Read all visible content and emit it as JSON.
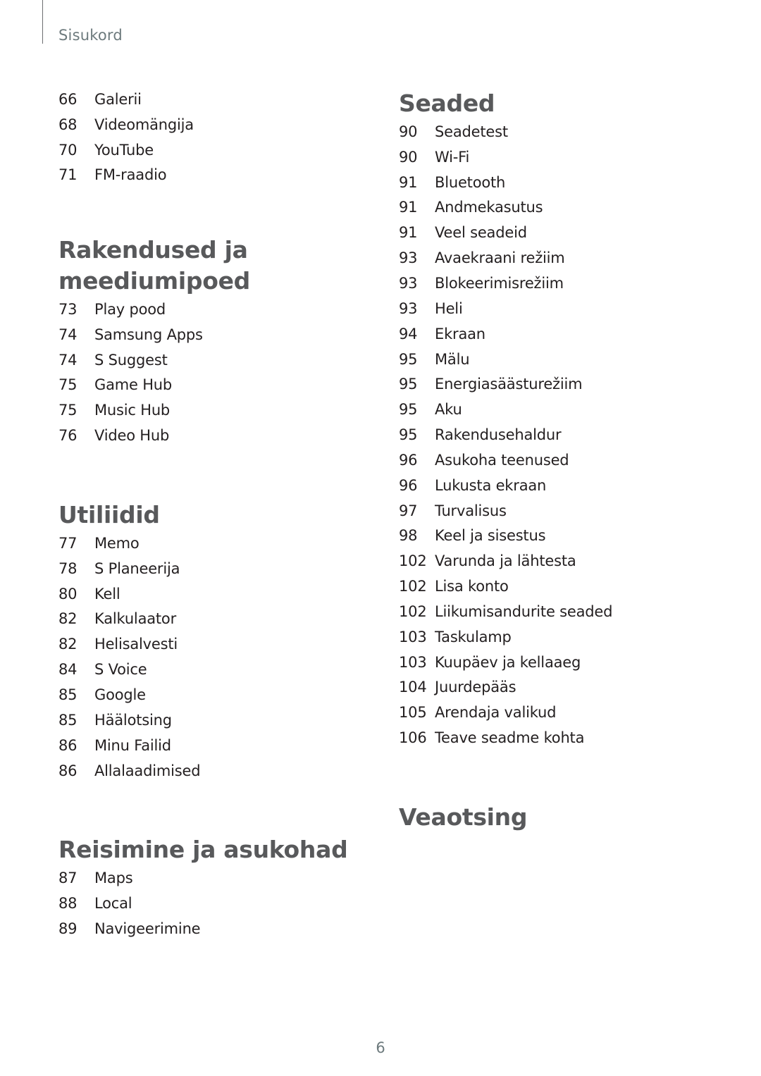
{
  "header": {
    "title": "Sisukord"
  },
  "left_column": {
    "intro_items": [
      {
        "page": "66",
        "label": "Galerii"
      },
      {
        "page": "68",
        "label": "Videomängija"
      },
      {
        "page": "70",
        "label": "YouTube"
      },
      {
        "page": "71",
        "label": "FM-raadio"
      }
    ],
    "sections": [
      {
        "title_line1": "Rakendused ja",
        "title_line2": "meediumipoed",
        "items": [
          {
            "page": "73",
            "label": "Play pood"
          },
          {
            "page": "74",
            "label": "Samsung Apps"
          },
          {
            "page": "74",
            "label": "S Suggest"
          },
          {
            "page": "75",
            "label": "Game Hub"
          },
          {
            "page": "75",
            "label": "Music Hub"
          },
          {
            "page": "76",
            "label": "Video Hub"
          }
        ]
      },
      {
        "title": "Utiliidid",
        "items": [
          {
            "page": "77",
            "label": "Memo"
          },
          {
            "page": "78",
            "label": "S Planeerija"
          },
          {
            "page": "80",
            "label": "Kell"
          },
          {
            "page": "82",
            "label": "Kalkulaator"
          },
          {
            "page": "82",
            "label": "Helisalvesti"
          },
          {
            "page": "84",
            "label": "S Voice"
          },
          {
            "page": "85",
            "label": "Google"
          },
          {
            "page": "85",
            "label": "Häälotsing"
          },
          {
            "page": "86",
            "label": "Minu Failid"
          },
          {
            "page": "86",
            "label": "Allalaadimised"
          }
        ]
      },
      {
        "title": "Reisimine ja asukohad",
        "items": [
          {
            "page": "87",
            "label": "Maps"
          },
          {
            "page": "88",
            "label": "Local"
          },
          {
            "page": "89",
            "label": "Navigeerimine"
          }
        ]
      }
    ]
  },
  "right_column": {
    "sections": [
      {
        "title": "Seaded",
        "items": [
          {
            "page": "90",
            "label": "Seadetest"
          },
          {
            "page": "90",
            "label": "Wi-Fi"
          },
          {
            "page": "91",
            "label": "Bluetooth"
          },
          {
            "page": "91",
            "label": "Andmekasutus"
          },
          {
            "page": "91",
            "label": "Veel seadeid"
          },
          {
            "page": "93",
            "label": "Avaekraani režiim"
          },
          {
            "page": "93",
            "label": "Blokeerimisrežiim"
          },
          {
            "page": "93",
            "label": "Heli"
          },
          {
            "page": "94",
            "label": "Ekraan"
          },
          {
            "page": "95",
            "label": "Mälu"
          },
          {
            "page": "95",
            "label": "Energiasäästurežiim"
          },
          {
            "page": "95",
            "label": "Aku"
          },
          {
            "page": "95",
            "label": "Rakendusehaldur"
          },
          {
            "page": "96",
            "label": "Asukoha teenused"
          },
          {
            "page": "96",
            "label": "Lukusta ekraan"
          },
          {
            "page": "97",
            "label": "Turvalisus"
          },
          {
            "page": "98",
            "label": "Keel ja sisestus"
          },
          {
            "page": "102",
            "label": "Varunda ja lähtesta"
          },
          {
            "page": "102",
            "label": "Lisa konto"
          },
          {
            "page": "102",
            "label": "Liikumisandurite seaded"
          },
          {
            "page": "103",
            "label": "Taskulamp"
          },
          {
            "page": "103",
            "label": "Kuupäev ja kellaaeg"
          },
          {
            "page": "104",
            "label": "Juurdepääs"
          },
          {
            "page": "105",
            "label": "Arendaja valikud"
          },
          {
            "page": "106",
            "label": "Teave seadme kohta"
          }
        ]
      },
      {
        "title": "Veaotsing",
        "items": []
      }
    ]
  },
  "footer": {
    "page_number": "6"
  }
}
